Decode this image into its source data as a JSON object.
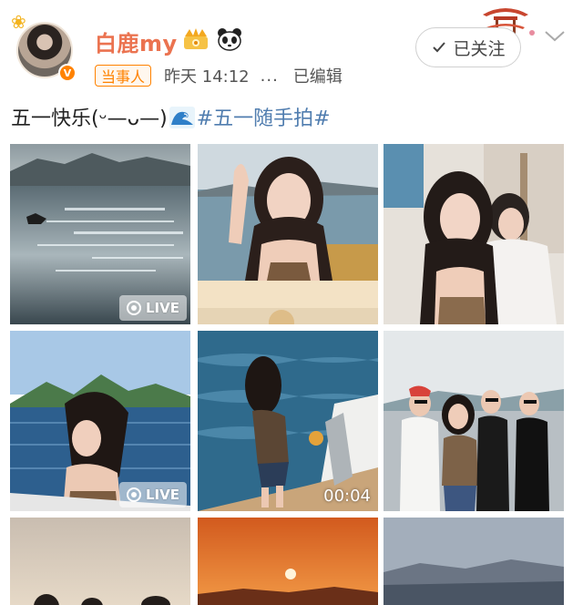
{
  "user": {
    "name": "白鹿my",
    "tag": "当事人",
    "time": "昨天 14:12",
    "more": "...",
    "edited": "已编辑",
    "verified_badge": "V"
  },
  "follow": {
    "label": "已关注"
  },
  "post": {
    "text_before": "五一快乐(ᵕ—ᴗ—)",
    "hashtag": "#五一随手拍#"
  },
  "icons": [
    "sunflower-icon",
    "crown-icon",
    "panda-icon",
    "pavilion-icon",
    "check-icon",
    "chevron-down-icon",
    "wave-icon",
    "live-photo-icon"
  ],
  "photos": {
    "live_label": "LIVE",
    "video_duration": "00:04"
  },
  "colors": {
    "username": "#eb7350",
    "tag": "#ff8200",
    "hashtag": "#507daf"
  }
}
